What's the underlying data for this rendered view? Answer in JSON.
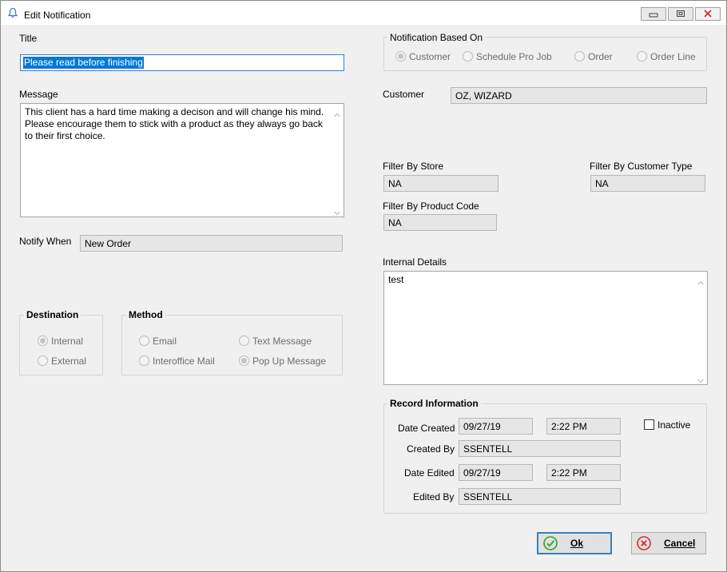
{
  "window": {
    "title": "Edit Notification"
  },
  "left": {
    "title_label": "Title",
    "title_value": "Please read before finishing",
    "message_label": "Message",
    "message_lines": [
      "This client has a hard time making a decison and will change his mind.",
      "Please encourage them to stick with a product as they always go back",
      "to their first choice."
    ],
    "notify_label": "Notify When",
    "notify_value": "New Order"
  },
  "destination": {
    "title": "Destination",
    "options": [
      {
        "label": "Internal",
        "checked": true
      },
      {
        "label": "External",
        "checked": false
      }
    ]
  },
  "method": {
    "title": "Method",
    "options": [
      {
        "label": "Email",
        "checked": false
      },
      {
        "label": "Text Message",
        "checked": false
      },
      {
        "label": "Interoffice Mail",
        "checked": false
      },
      {
        "label": "Pop Up Message",
        "checked": true
      }
    ]
  },
  "based_on": {
    "title": "Notification Based On",
    "options": [
      {
        "label": "Customer",
        "checked": true
      },
      {
        "label": "Schedule Pro Job",
        "checked": false
      },
      {
        "label": "Order",
        "checked": false
      },
      {
        "label": "Order Line",
        "checked": false
      }
    ]
  },
  "right": {
    "customer_label": "Customer",
    "customer_value": "OZ, WIZARD",
    "store_label": "Filter By Store",
    "store_value": "NA",
    "customer_type_label": "Filter By Customer Type",
    "customer_type_value": "NA",
    "product_code_label": "Filter By Product Code",
    "product_code_value": "NA",
    "internal_label": "Internal Details",
    "internal_value": "test"
  },
  "record": {
    "title": "Record Information",
    "date_created_label": "Date Created",
    "date_created": "09/27/19",
    "time_created": "2:22 PM",
    "created_by_label": "Created By",
    "created_by": "SSENTELL",
    "date_edited_label": "Date Edited",
    "date_edited": "09/27/19",
    "time_edited": "2:22 PM",
    "edited_by_label": "Edited By",
    "edited_by": "SSENTELL",
    "inactive_label": "Inactive",
    "inactive_checked": false
  },
  "buttons": {
    "ok": "Ok",
    "cancel": "Cancel"
  },
  "colors": {
    "ok_icon": "#2aa52a",
    "cancel_icon": "#d42a2a",
    "selection": "#0078d7"
  }
}
